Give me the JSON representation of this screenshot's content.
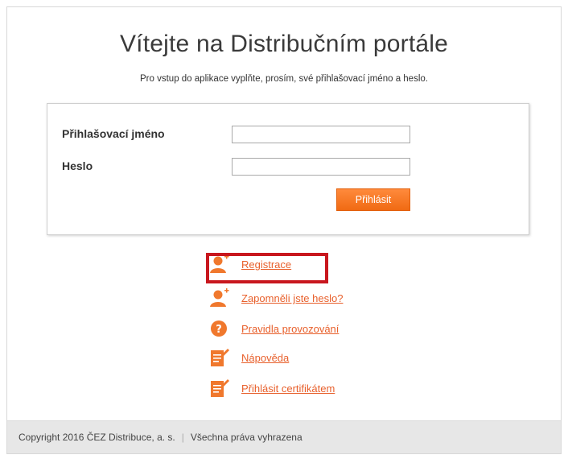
{
  "header": {
    "title": "Vítejte na Distribučním portále",
    "subtitle": "Pro vstup do aplikace vyplňte, prosím, své přihlašovací jméno a heslo."
  },
  "login": {
    "username_label": "Přihlašovací jméno",
    "username_value": "",
    "password_label": "Heslo",
    "password_value": "",
    "submit_label": "Přihlásit"
  },
  "links": [
    {
      "label": "Registrace",
      "icon": "user-add-icon"
    },
    {
      "label": "Zapomněli jste heslo?",
      "icon": "user-add-icon"
    },
    {
      "label": "Pravidla provozování",
      "icon": "help-icon"
    },
    {
      "label": "Nápověda",
      "icon": "document-edit-icon"
    },
    {
      "label": "Přihlásit certifikátem",
      "icon": "document-edit-icon"
    }
  ],
  "footer": {
    "copyright": "Copyright 2016 ČEZ Distribuce, a. s.",
    "separator": "|",
    "rights": "Všechna práva vyhrazena"
  },
  "colors": {
    "accent": "#f06a13",
    "link": "#e8602c",
    "highlight": "#c8171e"
  }
}
